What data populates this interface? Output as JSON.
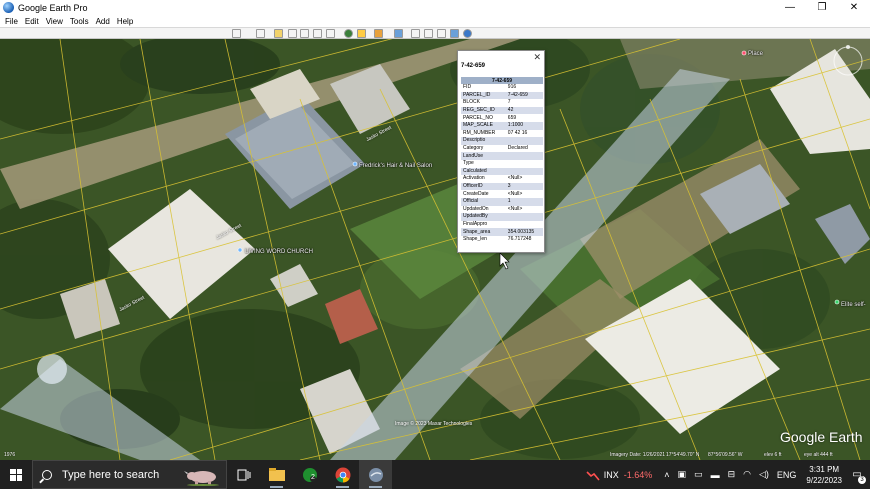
{
  "window": {
    "title": "Google Earth Pro",
    "controls": {
      "minimize": "—",
      "maximize": "❐",
      "close": "✕"
    }
  },
  "menu": [
    "File",
    "Edit",
    "View",
    "Tools",
    "Add",
    "Help"
  ],
  "map": {
    "place_labels": {
      "pet_salon": "Fredrick's Hair & Nail Salon",
      "church": "LIVING WORD CHURCH",
      "elite": "Elite self-",
      "top_right": "Place"
    },
    "road_labels": {
      "r1": "Jasko Street",
      "r2": "Jasko Street",
      "r3": "Jasko Street"
    },
    "imagery_credit": "Image © 2023 Maxar Technologies",
    "watermark": "Google Earth",
    "status": {
      "scale": "1976",
      "imagery_date": "Imagery Date: 1/26/2021",
      "lat": "17°54'49.70\" N",
      "lon": "87°56'09.56\" W",
      "elev": "elev  6 ft",
      "eye_alt": "eye alt   444 ft"
    }
  },
  "popup": {
    "title": "7-42-659",
    "header": "7-42-659",
    "rows": [
      {
        "key": "FID",
        "value": "916"
      },
      {
        "key": "PARCEL_ID",
        "value": "7-42-659"
      },
      {
        "key": "BLOCK",
        "value": "7"
      },
      {
        "key": "REG_SEC_ID",
        "value": "42"
      },
      {
        "key": "PARCEL_NO",
        "value": "659"
      },
      {
        "key": "MAP_SCALE",
        "value": "1:1000"
      },
      {
        "key": "RM_NUMBER",
        "value": "07 42 16"
      },
      {
        "key": "Descriptio",
        "value": ""
      },
      {
        "key": "Category",
        "value": "Declared"
      },
      {
        "key": "LandUse",
        "value": ""
      },
      {
        "key": "Type",
        "value": ""
      },
      {
        "key": "Calculated",
        "value": ""
      },
      {
        "key": "Activation",
        "value": "<Null>"
      },
      {
        "key": "OfficerID",
        "value": "3"
      },
      {
        "key": "CreateDate",
        "value": "<Null>"
      },
      {
        "key": "Official",
        "value": "1"
      },
      {
        "key": "UpdatedOn",
        "value": "<Null>"
      },
      {
        "key": "UpdatedBy",
        "value": ""
      },
      {
        "key": "FinalAppro",
        "value": ""
      },
      {
        "key": "Shape_area",
        "value": "354.003135"
      },
      {
        "key": "Shape_len",
        "value": "76.717248"
      }
    ]
  },
  "taskbar": {
    "search_placeholder": "Type here to search",
    "chrome_badge": "2",
    "stock_name": "INX",
    "stock_change": "-1.64%",
    "language": "ENG",
    "time": "3:31 PM",
    "date": "9/22/2023",
    "notification_count": "3"
  }
}
